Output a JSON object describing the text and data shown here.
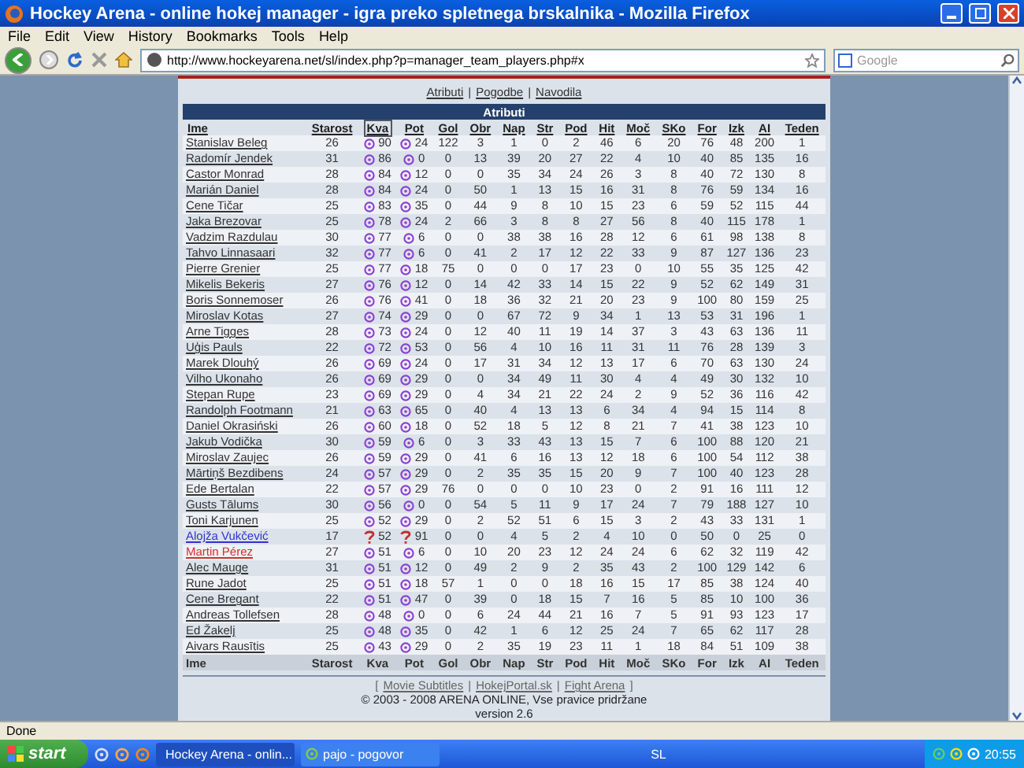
{
  "window": {
    "title": "Hockey Arena - online hokej manager - igra preko spletnega brskalnika - Mozilla Firefox"
  },
  "menu": [
    "File",
    "Edit",
    "View",
    "History",
    "Bookmarks",
    "Tools",
    "Help"
  ],
  "address": {
    "value": "http://www.hockeyarena.net/sl/index.php?p=manager_team_players.php#x"
  },
  "search": {
    "placeholder": "Google"
  },
  "page_links": [
    {
      "kind": "link",
      "text": "Atributi"
    },
    {
      "kind": "separator",
      "text": "|"
    },
    {
      "kind": "link",
      "text": "Pogodbe"
    },
    {
      "kind": "separator",
      "text": "|"
    },
    {
      "kind": "link",
      "text": "Navodila"
    }
  ],
  "table": {
    "title": "Atributi",
    "columns": [
      {
        "label": "Ime",
        "selected": false
      },
      {
        "label": "Starost",
        "selected": false
      },
      {
        "label": "Kva",
        "selected": true
      },
      {
        "label": "Pot",
        "selected": false
      },
      {
        "label": "Gol",
        "selected": false
      },
      {
        "label": "Obr",
        "selected": false
      },
      {
        "label": "Nap",
        "selected": false
      },
      {
        "label": "Str",
        "selected": false
      },
      {
        "label": "Pod",
        "selected": false
      },
      {
        "label": "Hit",
        "selected": false
      },
      {
        "label": "Moč",
        "selected": false
      },
      {
        "label": "SKo",
        "selected": false
      },
      {
        "label": "For",
        "selected": false
      },
      {
        "label": "Izk",
        "selected": false
      },
      {
        "label": "AI",
        "selected": false
      },
      {
        "label": "Teden",
        "selected": false
      }
    ],
    "rows": [
      {
        "color": "#333333",
        "scouted": true,
        "cells": [
          "Stanislav Beleg",
          "26",
          "90",
          "24",
          "122",
          "3",
          "1",
          "0",
          "2",
          "46",
          "6",
          "20",
          "76",
          "48",
          "200",
          "1"
        ]
      },
      {
        "color": "#333333",
        "scouted": true,
        "cells": [
          "Radomír Jendek",
          "31",
          "86",
          "0",
          "0",
          "13",
          "39",
          "20",
          "27",
          "22",
          "4",
          "10",
          "40",
          "85",
          "135",
          "16"
        ]
      },
      {
        "color": "#333333",
        "scouted": true,
        "cells": [
          "Castor Monrad",
          "28",
          "84",
          "12",
          "0",
          "0",
          "35",
          "34",
          "24",
          "26",
          "3",
          "8",
          "40",
          "72",
          "130",
          "8"
        ]
      },
      {
        "color": "#333333",
        "scouted": true,
        "cells": [
          "Marián Daniel",
          "28",
          "84",
          "24",
          "0",
          "50",
          "1",
          "13",
          "15",
          "16",
          "31",
          "8",
          "76",
          "59",
          "134",
          "16"
        ]
      },
      {
        "color": "#333333",
        "scouted": true,
        "cells": [
          "Cene Tičar",
          "25",
          "83",
          "35",
          "0",
          "44",
          "9",
          "8",
          "10",
          "15",
          "23",
          "6",
          "59",
          "52",
          "115",
          "44"
        ]
      },
      {
        "color": "#333333",
        "scouted": true,
        "cells": [
          "Jaka Brezovar",
          "25",
          "78",
          "24",
          "2",
          "66",
          "3",
          "8",
          "8",
          "27",
          "56",
          "8",
          "40",
          "115",
          "178",
          "1"
        ]
      },
      {
        "color": "#333333",
        "scouted": true,
        "cells": [
          "Vadzim Razdulau",
          "30",
          "77",
          "6",
          "0",
          "0",
          "38",
          "38",
          "16",
          "28",
          "12",
          "6",
          "61",
          "98",
          "138",
          "8"
        ]
      },
      {
        "color": "#333333",
        "scouted": true,
        "cells": [
          "Tahvo Linnasaari",
          "32",
          "77",
          "6",
          "0",
          "41",
          "2",
          "17",
          "12",
          "22",
          "33",
          "9",
          "87",
          "127",
          "136",
          "23"
        ]
      },
      {
        "color": "#333333",
        "scouted": true,
        "cells": [
          "Pierre Grenier",
          "25",
          "77",
          "18",
          "75",
          "0",
          "0",
          "0",
          "17",
          "23",
          "0",
          "10",
          "55",
          "35",
          "125",
          "42"
        ]
      },
      {
        "color": "#333333",
        "scouted": true,
        "cells": [
          "Mikelis Bekeris",
          "27",
          "76",
          "12",
          "0",
          "14",
          "42",
          "33",
          "14",
          "15",
          "22",
          "9",
          "52",
          "62",
          "149",
          "31"
        ]
      },
      {
        "color": "#333333",
        "scouted": true,
        "cells": [
          "Boris Sonnemoser",
          "26",
          "76",
          "41",
          "0",
          "18",
          "36",
          "32",
          "21",
          "20",
          "23",
          "9",
          "100",
          "80",
          "159",
          "25"
        ]
      },
      {
        "color": "#333333",
        "scouted": true,
        "cells": [
          "Miroslav Kotas",
          "27",
          "74",
          "29",
          "0",
          "0",
          "67",
          "72",
          "9",
          "34",
          "1",
          "13",
          "53",
          "31",
          "196",
          "1"
        ]
      },
      {
        "color": "#333333",
        "scouted": true,
        "cells": [
          "Arne Tigges",
          "28",
          "73",
          "24",
          "0",
          "12",
          "40",
          "11",
          "19",
          "14",
          "37",
          "3",
          "43",
          "63",
          "136",
          "11"
        ]
      },
      {
        "color": "#333333",
        "scouted": true,
        "cells": [
          "Uģis Pauls",
          "22",
          "72",
          "53",
          "0",
          "56",
          "4",
          "10",
          "16",
          "11",
          "31",
          "11",
          "76",
          "28",
          "139",
          "3"
        ]
      },
      {
        "color": "#333333",
        "scouted": true,
        "cells": [
          "Marek Dlouhý",
          "26",
          "69",
          "24",
          "0",
          "17",
          "31",
          "34",
          "12",
          "13",
          "17",
          "6",
          "70",
          "63",
          "130",
          "24"
        ]
      },
      {
        "color": "#333333",
        "scouted": true,
        "cells": [
          "Vilho Ukonaho",
          "26",
          "69",
          "29",
          "0",
          "0",
          "34",
          "49",
          "11",
          "30",
          "4",
          "4",
          "49",
          "30",
          "132",
          "10"
        ]
      },
      {
        "color": "#333333",
        "scouted": true,
        "cells": [
          "Stepan Rupe",
          "23",
          "69",
          "29",
          "0",
          "4",
          "34",
          "21",
          "22",
          "24",
          "2",
          "9",
          "52",
          "36",
          "116",
          "42"
        ]
      },
      {
        "color": "#333333",
        "scouted": true,
        "cells": [
          "Randolph Footmann",
          "21",
          "63",
          "65",
          "0",
          "40",
          "4",
          "13",
          "13",
          "6",
          "34",
          "4",
          "94",
          "15",
          "114",
          "8"
        ]
      },
      {
        "color": "#333333",
        "scouted": true,
        "cells": [
          "Daniel Okrasiński",
          "26",
          "60",
          "18",
          "0",
          "52",
          "18",
          "5",
          "12",
          "8",
          "21",
          "7",
          "41",
          "38",
          "123",
          "10"
        ]
      },
      {
        "color": "#333333",
        "scouted": true,
        "cells": [
          "Jakub Vodička",
          "30",
          "59",
          "6",
          "0",
          "3",
          "33",
          "43",
          "13",
          "15",
          "7",
          "6",
          "100",
          "88",
          "120",
          "21"
        ]
      },
      {
        "color": "#333333",
        "scouted": true,
        "cells": [
          "Miroslav Zaujec",
          "26",
          "59",
          "29",
          "0",
          "41",
          "6",
          "16",
          "13",
          "12",
          "18",
          "6",
          "100",
          "54",
          "112",
          "38"
        ]
      },
      {
        "color": "#333333",
        "scouted": true,
        "cells": [
          "Mārtiņš Bezdibens",
          "24",
          "57",
          "29",
          "0",
          "2",
          "35",
          "35",
          "15",
          "20",
          "9",
          "7",
          "100",
          "40",
          "123",
          "28"
        ]
      },
      {
        "color": "#333333",
        "scouted": true,
        "cells": [
          "Ede Bertalan",
          "22",
          "57",
          "29",
          "76",
          "0",
          "0",
          "0",
          "10",
          "23",
          "0",
          "2",
          "91",
          "16",
          "111",
          "12"
        ]
      },
      {
        "color": "#333333",
        "scouted": true,
        "cells": [
          "Gusts Tālums",
          "30",
          "56",
          "0",
          "0",
          "54",
          "5",
          "11",
          "9",
          "17",
          "24",
          "7",
          "79",
          "188",
          "127",
          "10"
        ]
      },
      {
        "color": "#333333",
        "scouted": true,
        "cells": [
          "Toni Karjunen",
          "25",
          "52",
          "29",
          "0",
          "2",
          "52",
          "51",
          "6",
          "15",
          "3",
          "2",
          "43",
          "33",
          "131",
          "1"
        ]
      },
      {
        "color": "#3333cc",
        "scouted": false,
        "cells": [
          "Alojža Vukčević",
          "17",
          "52",
          "91",
          "0",
          "0",
          "4",
          "5",
          "2",
          "4",
          "10",
          "0",
          "50",
          "0",
          "25",
          "0"
        ]
      },
      {
        "color": "#cc3333",
        "scouted": true,
        "cells": [
          "Martin Pérez",
          "27",
          "51",
          "6",
          "0",
          "10",
          "20",
          "23",
          "12",
          "24",
          "24",
          "6",
          "62",
          "32",
          "119",
          "42"
        ]
      },
      {
        "color": "#333333",
        "scouted": true,
        "cells": [
          "Alec Mauge",
          "31",
          "51",
          "12",
          "0",
          "49",
          "2",
          "9",
          "2",
          "35",
          "43",
          "2",
          "100",
          "129",
          "142",
          "6"
        ]
      },
      {
        "color": "#333333",
        "scouted": true,
        "cells": [
          "Rune Jadot",
          "25",
          "51",
          "18",
          "57",
          "1",
          "0",
          "0",
          "18",
          "16",
          "15",
          "17",
          "85",
          "38",
          "124",
          "40"
        ]
      },
      {
        "color": "#333333",
        "scouted": true,
        "cells": [
          "Cene Bregant",
          "22",
          "51",
          "47",
          "0",
          "39",
          "0",
          "18",
          "15",
          "7",
          "16",
          "5",
          "85",
          "10",
          "100",
          "36"
        ]
      },
      {
        "color": "#333333",
        "scouted": true,
        "cells": [
          "Andreas Tollefsen",
          "28",
          "48",
          "0",
          "0",
          "6",
          "24",
          "44",
          "21",
          "16",
          "7",
          "5",
          "91",
          "93",
          "123",
          "17"
        ]
      },
      {
        "color": "#333333",
        "scouted": true,
        "cells": [
          "Ed Žakelj",
          "25",
          "48",
          "35",
          "0",
          "42",
          "1",
          "6",
          "12",
          "25",
          "24",
          "7",
          "65",
          "62",
          "117",
          "28"
        ]
      },
      {
        "color": "#333333",
        "scouted": true,
        "cells": [
          "Aivars Rausītis",
          "25",
          "43",
          "29",
          "0",
          "2",
          "35",
          "19",
          "23",
          "11",
          "1",
          "18",
          "84",
          "51",
          "109",
          "38"
        ]
      }
    ],
    "footer_columns": [
      "Ime",
      "Starost",
      "Kva",
      "Pot",
      "Gol",
      "Obr",
      "Nap",
      "Str",
      "Pod",
      "Hit",
      "Moč",
      "SKo",
      "For",
      "Izk",
      "AI",
      "Teden"
    ]
  },
  "footer_links": [
    {
      "kind": "separator",
      "text": "["
    },
    {
      "kind": "link",
      "text": "Movie Subtitles"
    },
    {
      "kind": "separator",
      "text": "|"
    },
    {
      "kind": "link",
      "text": "HokejPortal.sk"
    },
    {
      "kind": "separator",
      "text": "|"
    },
    {
      "kind": "link",
      "text": "Fight Arena"
    },
    {
      "kind": "separator",
      "text": "]"
    }
  ],
  "copyright": "© 2003 - 2008 ARENA ONLINE, Vse pravice pridržane",
  "version": "version 2.6",
  "status_bar": "Done",
  "taskbar": {
    "start": "start",
    "tasks": [
      {
        "label": "Hockey Arena - onlin...",
        "selected": true
      },
      {
        "label": "pajo - pogovor",
        "selected": false
      }
    ],
    "language": "SL",
    "clock": "20:55"
  }
}
